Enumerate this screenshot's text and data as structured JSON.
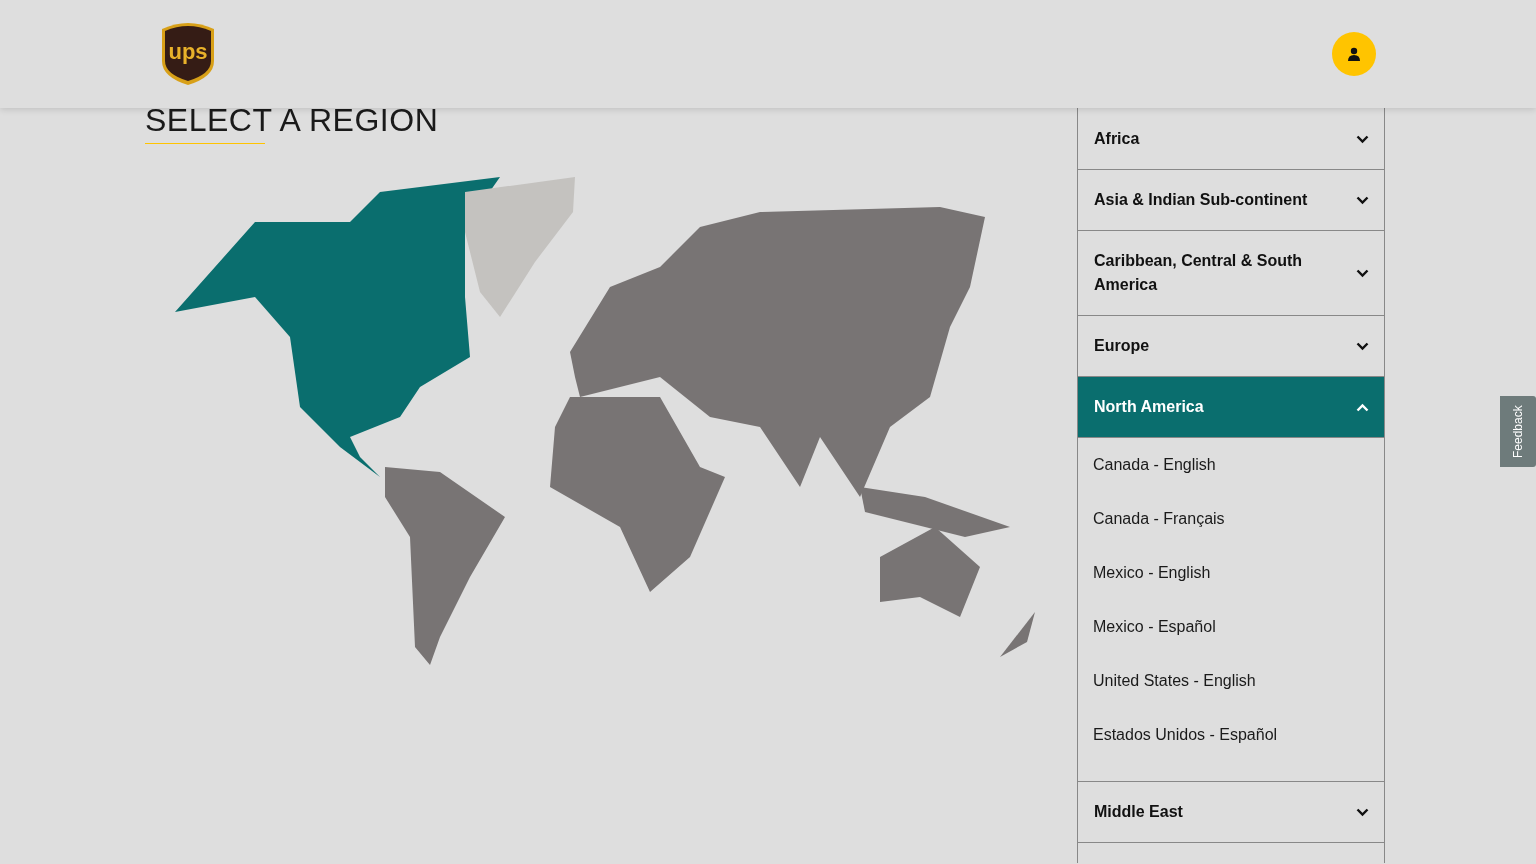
{
  "header": {
    "logo_text": "ups"
  },
  "title": "SELECT A REGION",
  "regions": [
    {
      "label": "Africa",
      "expanded": false
    },
    {
      "label": "Asia & Indian Sub-continent",
      "expanded": false
    },
    {
      "label": "Caribbean, Central & South America",
      "expanded": false
    },
    {
      "label": "Europe",
      "expanded": false
    },
    {
      "label": "North America",
      "expanded": true,
      "options": [
        "Canada - English",
        "Canada - Français",
        "Mexico - English",
        "Mexico - Español",
        "United States - English",
        "Estados Unidos - Español"
      ]
    },
    {
      "label": "Middle East",
      "expanded": false
    }
  ],
  "feedback_tab": "Feedback"
}
